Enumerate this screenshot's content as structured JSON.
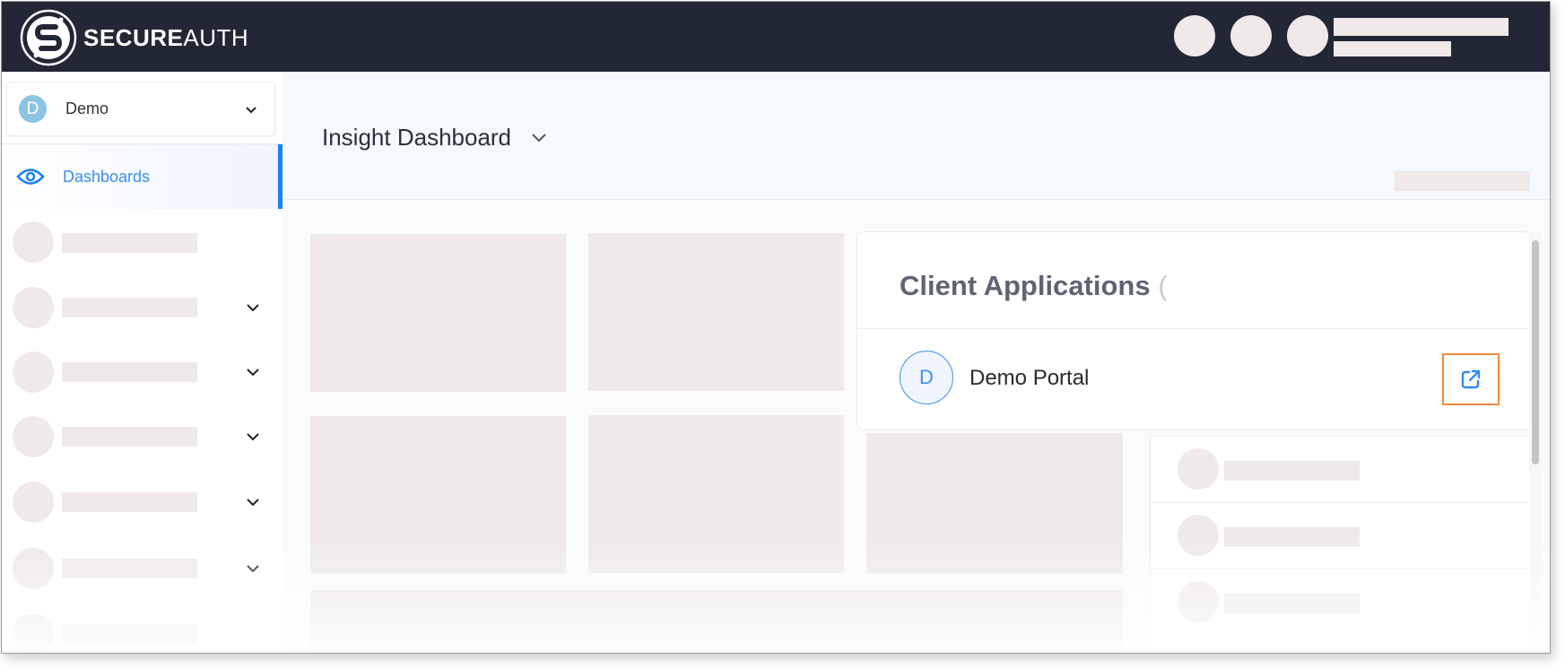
{
  "brand": {
    "name_bold": "SECURE",
    "name_light": "AUTH"
  },
  "colors": {
    "topbar": "#222736",
    "accent": "#1a82f5",
    "highlight_border": "#f58a3d",
    "skeleton": "#efe9e9"
  },
  "sidebar": {
    "tenant": {
      "avatar_letter": "D",
      "label": "Demo"
    },
    "active_item": {
      "label": "Dashboards",
      "icon": "eye-icon"
    }
  },
  "header": {
    "title": "Insight Dashboard"
  },
  "client_applications": {
    "title": "Client Applications",
    "title_suffix": "(",
    "apps": [
      {
        "avatar_letter": "D",
        "name": "Demo Portal",
        "action_icon": "external-link-icon"
      }
    ]
  }
}
